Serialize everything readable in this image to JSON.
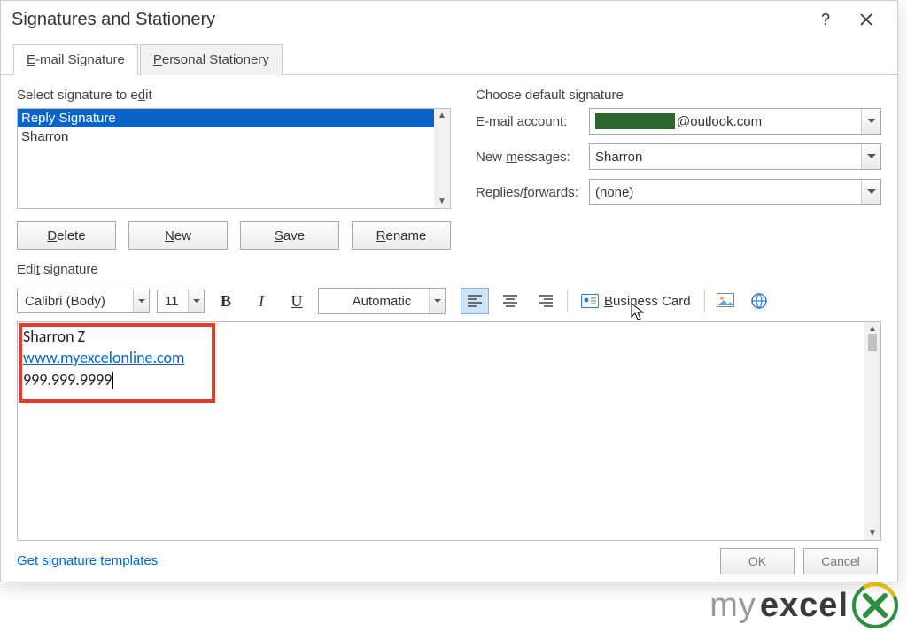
{
  "dialog": {
    "title": "Signatures and Stationery"
  },
  "tabs": {
    "email_prefix": "E",
    "email_rest": "-mail Signature",
    "personal_prefix": "P",
    "personal_rest": "ersonal Stationery"
  },
  "left_panel": {
    "select_label_pre": "Select signature to e",
    "select_label_u": "d",
    "select_label_post": "it",
    "signatures": [
      {
        "name": "Reply Signature",
        "selected": true
      },
      {
        "name": "Sharron",
        "selected": false
      }
    ],
    "buttons": {
      "delete_u": "D",
      "delete_rest": "elete",
      "new_u": "N",
      "new_rest": "ew",
      "save_u": "S",
      "save_rest": "ave",
      "rename_u": "R",
      "rename_rest": "ename"
    }
  },
  "right_panel": {
    "heading": "Choose default signature",
    "email_account_label_pre": "E-mail a",
    "email_account_label_u": "c",
    "email_account_label_post": "count:",
    "email_account_suffix": "@outlook.com",
    "new_messages_label_pre": "New ",
    "new_messages_label_u": "m",
    "new_messages_label_post": "essages:",
    "new_messages_value": "Sharron",
    "replies_label_pre": "Replies/",
    "replies_label_u": "f",
    "replies_label_post": "orwards:",
    "replies_value": "(none)"
  },
  "edit": {
    "label_pre": "Edi",
    "label_u": "t",
    "label_post": " signature",
    "font_name": "Calibri (Body)",
    "font_size": "11",
    "color": "Automatic",
    "bizcard_u": "B",
    "bizcard_rest": "usiness Card"
  },
  "sig_content": {
    "line1": "Sharron Z",
    "link": "www.myexcelonline.com",
    "line3": "999.999.9999"
  },
  "templates_link": "Get signature templates",
  "footer": {
    "ok": "OK",
    "cancel": "Cancel"
  },
  "watermark": {
    "my": "my",
    "excel": "excel"
  }
}
